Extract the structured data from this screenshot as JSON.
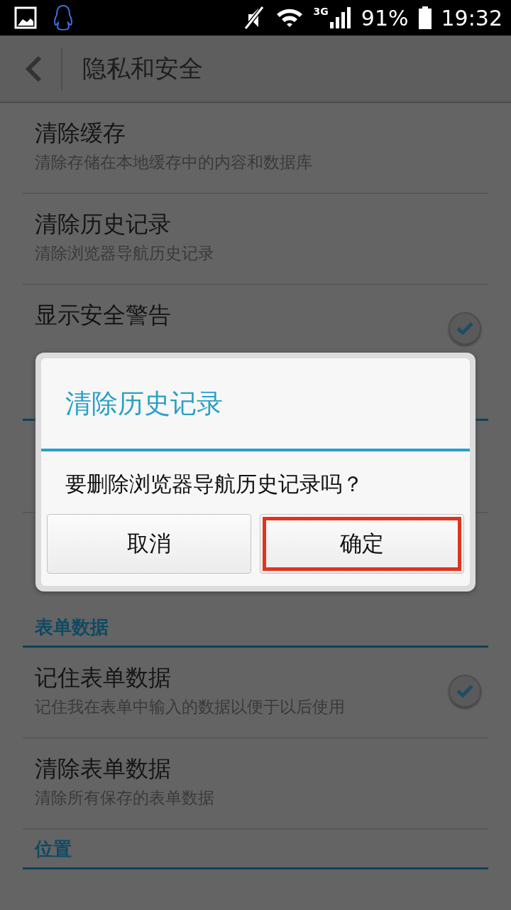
{
  "status_bar": {
    "network": "3G",
    "battery": "91%",
    "time": "19:32"
  },
  "header": {
    "title": "隐私和安全"
  },
  "sections": [
    {
      "items": [
        {
          "kind": "item",
          "title": "清除缓存",
          "summary": "清除存储在本地缓存中的内容和数据库"
        },
        {
          "kind": "item",
          "title": "清除历史记录",
          "summary": "清除浏览器导航历史记录"
        },
        {
          "kind": "checkbox",
          "title": "显示安全警告",
          "checked": true
        }
      ]
    },
    {
      "header": "表单数据",
      "items": [
        {
          "kind": "checkbox",
          "title": "记住表单数据",
          "summary": "记住我在表单中输入的数据以便于以后使用",
          "checked": true
        },
        {
          "kind": "item",
          "title": "清除表单数据",
          "summary": "清除所有保存的表单数据"
        }
      ]
    },
    {
      "header": "位置"
    }
  ],
  "dialog": {
    "title": "清除历史记录",
    "message": "要删除浏览器导航历史记录吗？",
    "buttons": [
      {
        "label": "取消",
        "highlighted": false
      },
      {
        "label": "确定",
        "highlighted": true
      }
    ]
  }
}
